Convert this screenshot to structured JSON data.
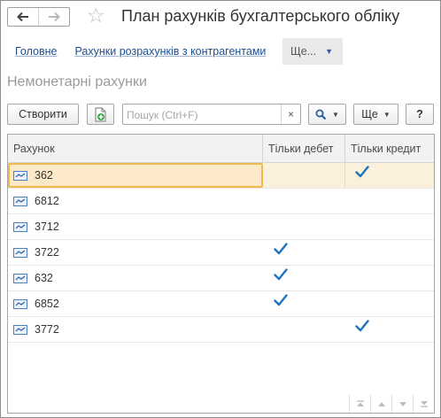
{
  "window": {
    "title": "План рахунків бухгалтерського обліку"
  },
  "nav": {
    "back": "🡐",
    "forward": "🡒"
  },
  "links": [
    {
      "label": "Головне"
    },
    {
      "label": "Рахунки розрахунків з контрагентами"
    }
  ],
  "more_tab": {
    "label": "Ще..."
  },
  "form_title": "Немонетарні рахунки",
  "toolbar": {
    "create_label": "Створити",
    "search_placeholder": "Пошук (Ctrl+F)",
    "clear_label": "×",
    "more_label": "Ще",
    "help_label": "?"
  },
  "table": {
    "columns": [
      "Рахунок",
      "Тільки дебет",
      "Тільки кредит"
    ],
    "rows": [
      {
        "code": "362",
        "debit_only": false,
        "credit_only": true,
        "selected": true
      },
      {
        "code": "6812",
        "debit_only": false,
        "credit_only": false,
        "selected": false
      },
      {
        "code": "3712",
        "debit_only": false,
        "credit_only": false,
        "selected": false
      },
      {
        "code": "3722",
        "debit_only": true,
        "credit_only": false,
        "selected": false
      },
      {
        "code": "632",
        "debit_only": true,
        "credit_only": false,
        "selected": false
      },
      {
        "code": "6852",
        "debit_only": true,
        "credit_only": false,
        "selected": false
      },
      {
        "code": "3772",
        "debit_only": false,
        "credit_only": true,
        "selected": false
      }
    ]
  },
  "icons": {
    "account": "account-icon",
    "check": "check-icon",
    "accent": "#1e73be"
  }
}
